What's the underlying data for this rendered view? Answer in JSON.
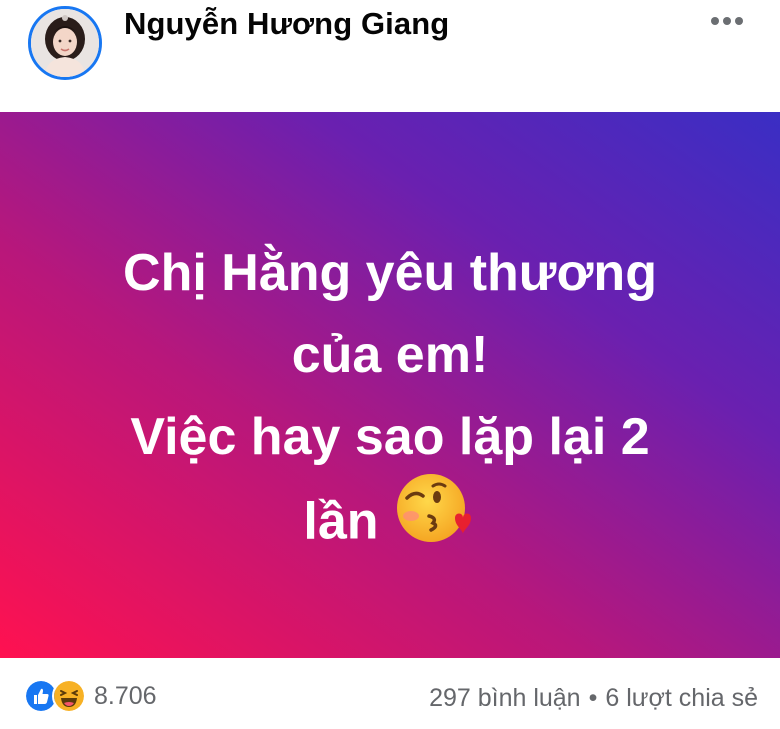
{
  "post": {
    "author": {
      "name": "Nguyễn Hương Giang",
      "avatar_icon": "profile-photo"
    },
    "menu_icon": "more-horizontal-icon",
    "background": {
      "gradient_colors": [
        "#ff1150",
        "#b8177b",
        "#6a20b0",
        "#3a2ec4"
      ]
    },
    "text_lines": [
      "Chị Hằng yêu thương",
      "của em!",
      "Việc hay sao lặp lại 2",
      "lần"
    ],
    "emoji": "face-blowing-a-kiss",
    "reactions": {
      "icons": [
        "like-icon",
        "haha-icon"
      ],
      "count": "8.706"
    },
    "stats": {
      "comments": "297 bình luận",
      "separator": "•",
      "shares": "6 lượt chia sẻ"
    },
    "colors": {
      "like_blue": "#1877f2",
      "haha_yellow": "#f7b125",
      "muted_text": "#65676b"
    }
  }
}
